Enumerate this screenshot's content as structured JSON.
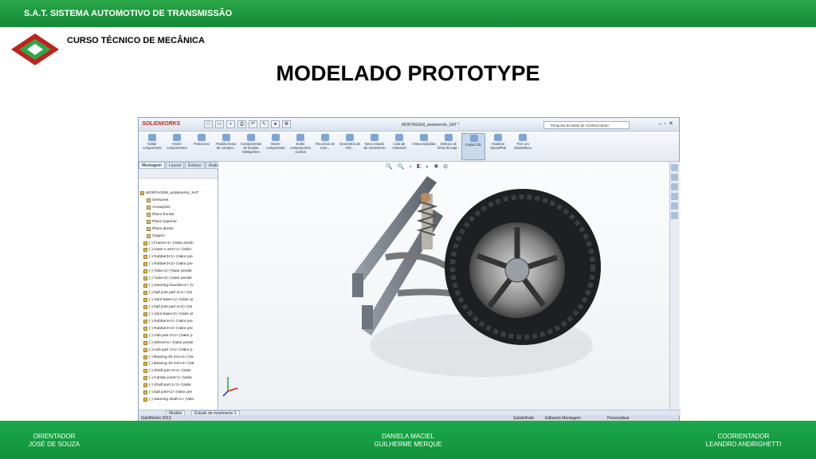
{
  "header": {
    "company": "S.A.T. SISTEMA AUTOMOTIVO DE TRANSMISSÃO",
    "course": "CURSO TÉCNICO DE MECÂNICA",
    "title": "MODELADO PROTOTYPE"
  },
  "footer": {
    "left": {
      "line1": "ORIENTADOR",
      "line2": "JOSÉ DE SOUZA"
    },
    "center": {
      "line1": "DANIELA MACIEL",
      "line2": "GUILHERME MERQUE"
    },
    "right": {
      "line1": "COORIENTADOR",
      "line2": "LEANDRO  ANDRIGHETTI"
    }
  },
  "app": {
    "brand": "SOLIDWORKS",
    "document_title": "MONTAGEM_andamento_SAT *",
    "search_placeholder": "Pesquisa da Base de Conhecimento",
    "ribbon": [
      {
        "label": "Editar componente"
      },
      {
        "label": "Inserir componentes"
      },
      {
        "label": "Posicionar"
      },
      {
        "label": "Padrão linear de compon..."
      },
      {
        "label": "Componentes de fixação inteligentes"
      },
      {
        "label": "Mover componente"
      },
      {
        "label": "Exibir componentes ocultos"
      },
      {
        "label": "Recursos de mon..."
      },
      {
        "label": "Geometria de refe..."
      },
      {
        "label": "Novo estudo de movimento"
      },
      {
        "label": "Lista de materiais"
      },
      {
        "label": "Vista explodida"
      },
      {
        "label": "Esboço de linha de expl..."
      },
      {
        "label": "Instant 3D"
      },
      {
        "label": "Atualizar SpeedPak"
      },
      {
        "label": "Tirar um instantâneo"
      }
    ],
    "tabs": [
      "Montagem",
      "Layout",
      "Esboço",
      "Avaliar"
    ],
    "tree": {
      "root": "MONTAGEM_andamento_SAT",
      "features": [
        "Sensores",
        "Anotações",
        "Plano frontal",
        "Plano superior",
        "Plano direito",
        "Origem"
      ],
      "components": [
        "(-) Frame<1> (Valor prede",
        "(-) lower A arm<1> (Valor",
        "(-) Rubber3<1> (Valor pre",
        "(-) Rubber3<2> (Valor pre",
        "(-) Tube<1> (Valor predet",
        "(-) Tube<2> (Valor predet",
        "(-) Steering knuckle<1> (V",
        "(-) ball joint part a<1> (Va",
        "(-) Joint base<1> (Valor pr",
        "(-) ball joint part a<2> (Va",
        "(-) Joint base<2> (Valor pr",
        "(-) Rubber3<1> (Valor pre",
        "(-) Rubber3<2> (Valor pre",
        "(-) Hub part 2<1> (Valor p",
        "(-) Wheel<1> (Valor prede",
        "(-) Hub part 1<1> (Valor p",
        "(-) Bearing 40 mm<1> (Va",
        "(-) Bearing 40 mm<2> (Val",
        "(-) Shaft part 2<1> (Valor",
        "(-) Cardan joint<1> (Valor",
        "(-) Shaft part 1<1> (Valor",
        "(-) ball joint<1> (Valor pre",
        "(-) Steering shaft<1> (Valo"
      ]
    },
    "bottom_tabs": [
      "Modelo",
      "Estudo de movimento 1"
    ],
    "status": {
      "app": "SolidWorks 2013",
      "state": "Subdefinido",
      "mode": "Editando Montagem",
      "customize": "Personalizar"
    }
  },
  "colors": {
    "green_bar": "#1a9a40",
    "title_text": "#000000",
    "accent_red": "#c0221f"
  }
}
